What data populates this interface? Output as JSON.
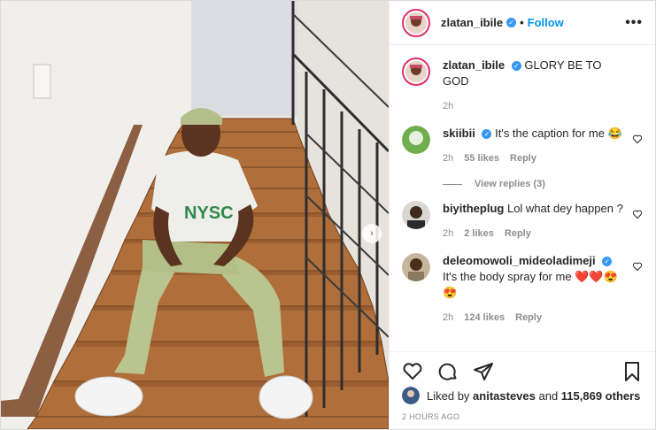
{
  "post": {
    "username": "zlatan_ibile",
    "follow_label": "Follow",
    "more_label": "•••",
    "separator": "•"
  },
  "caption": {
    "username": "zlatan_ibile",
    "text": "GLORY BE TO GOD",
    "age": "2h"
  },
  "comments": [
    {
      "username": "skiibii",
      "verified": true,
      "text": "It's the caption for me 😂",
      "age": "2h",
      "likes": "55 likes",
      "reply": "Reply",
      "view_replies": "View replies (3)"
    },
    {
      "username": "biyitheplug",
      "verified": false,
      "text": "Lol what dey happen ?",
      "age": "2h",
      "likes": "2 likes",
      "reply": "Reply"
    },
    {
      "username": "deleomowoli_mideoladimeji",
      "verified": true,
      "text": "It's the body spray for me ❤️❤️😍 😍",
      "age": "2h",
      "likes": "124 likes",
      "reply": "Reply"
    }
  ],
  "likes_summary": {
    "prefix": "Liked by ",
    "first_user": "anitasteves",
    "joiner": " and ",
    "others": "115,869 others"
  },
  "timestamp": "2 HOURS AGO",
  "photo_text": "NYSC",
  "icons": [
    "heart-icon",
    "comment-icon",
    "share-icon",
    "bookmark-icon",
    "verified-icon",
    "more-icon",
    "next-arrow-icon"
  ],
  "colors": {
    "accent": "#0095f6",
    "verified": "#3897f0",
    "muted": "#8e8e8e",
    "story_ring": "#e1306c"
  }
}
